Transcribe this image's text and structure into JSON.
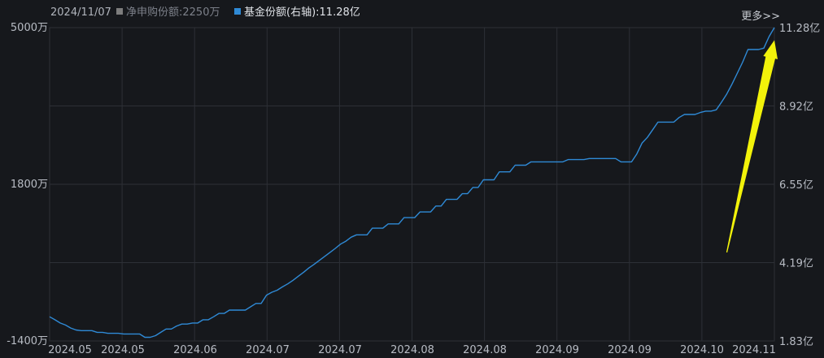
{
  "header": {
    "date": "2024/11/07",
    "legend_net": "净申购份额:2250万",
    "legend_fund": "基金份额(右轴):11.28亿",
    "more": "更多>>"
  },
  "colors": {
    "background": "#16181c",
    "grid": "#2d3036",
    "series": "#2f8ad6",
    "legend_grey": "#7d7d7d",
    "arrow": "#f2f20a"
  },
  "chart_data": {
    "type": "line",
    "title": "",
    "grid": true,
    "x_tick_labels": [
      "2024.05",
      "2024.05",
      "2024.06",
      "2024.07",
      "2024.07",
      "2024.08",
      "2024.08",
      "2024.09",
      "2024.09",
      "2024.10",
      "2024.11"
    ],
    "left_axis": {
      "ticks": [
        "5000万",
        "1800万",
        "-1400万"
      ],
      "ylim": [
        -1400,
        5000
      ],
      "unit": "万"
    },
    "right_axis": {
      "ticks": [
        "11.28亿",
        "8.92亿",
        "6.55亿",
        "4.19亿",
        "1.83亿"
      ],
      "ylim": [
        1.83,
        11.28
      ],
      "unit": "亿"
    },
    "series": [
      {
        "name": "基金份额(右轴)",
        "axis": "right",
        "values": [
          2.56,
          2.47,
          2.37,
          2.31,
          2.22,
          2.16,
          2.14,
          2.14,
          2.14,
          2.09,
          2.09,
          2.06,
          2.06,
          2.06,
          2.04,
          2.04,
          2.04,
          2.04,
          1.94,
          1.94,
          1.99,
          2.09,
          2.19,
          2.19,
          2.28,
          2.34,
          2.34,
          2.37,
          2.37,
          2.47,
          2.47,
          2.56,
          2.66,
          2.66,
          2.76,
          2.76,
          2.76,
          2.76,
          2.86,
          2.96,
          2.96,
          3.21,
          3.3,
          3.36,
          3.46,
          3.55,
          3.66,
          3.78,
          3.9,
          4.03,
          4.14,
          4.26,
          4.38,
          4.5,
          4.62,
          4.75,
          4.84,
          4.96,
          5.03,
          5.03,
          5.03,
          5.23,
          5.23,
          5.23,
          5.36,
          5.36,
          5.36,
          5.55,
          5.55,
          5.55,
          5.72,
          5.72,
          5.72,
          5.9,
          5.9,
          6.1,
          6.1,
          6.1,
          6.27,
          6.27,
          6.46,
          6.46,
          6.69,
          6.69,
          6.69,
          6.93,
          6.93,
          6.93,
          7.13,
          7.13,
          7.13,
          7.23,
          7.23,
          7.23,
          7.23,
          7.23,
          7.23,
          7.23,
          7.3,
          7.3,
          7.3,
          7.3,
          7.33,
          7.33,
          7.33,
          7.33,
          7.33,
          7.33,
          7.23,
          7.23,
          7.23,
          7.47,
          7.8,
          7.97,
          8.2,
          8.43,
          8.43,
          8.43,
          8.43,
          8.57,
          8.66,
          8.66,
          8.66,
          8.72,
          8.76,
          8.76,
          8.8,
          9.03,
          9.28,
          9.58,
          9.91,
          10.24,
          10.62,
          10.62,
          10.62,
          10.66,
          11.01,
          11.28
        ]
      }
    ],
    "annotation": {
      "type": "arrow",
      "from": [
        128,
        4.5
      ],
      "to": [
        137,
        10.9
      ]
    }
  }
}
